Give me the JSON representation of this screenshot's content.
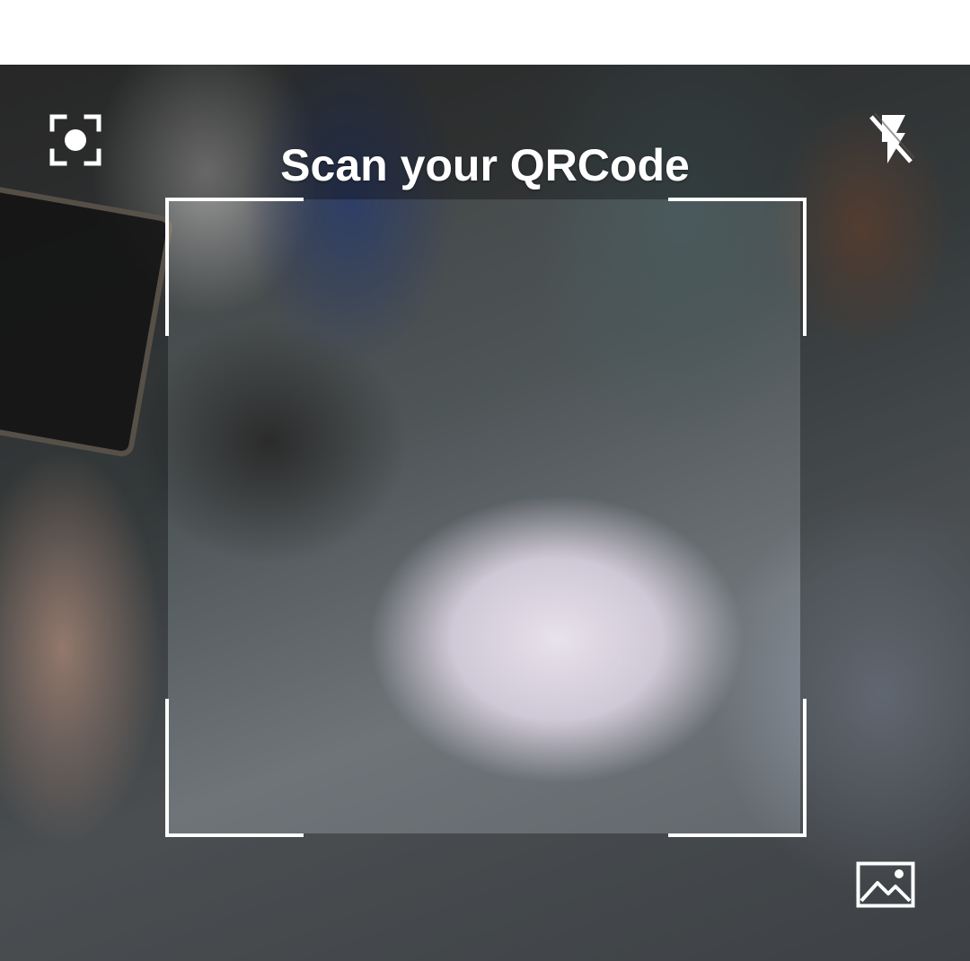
{
  "scanner": {
    "title": "Scan your QRCode"
  },
  "icons": {
    "focus": "camera-focus-icon",
    "flash": "flash-off-icon",
    "gallery": "gallery-image-icon"
  },
  "colors": {
    "overlay_text": "#ffffff",
    "frame_corners": "#ffffff",
    "top_bar": "#ffffff"
  }
}
